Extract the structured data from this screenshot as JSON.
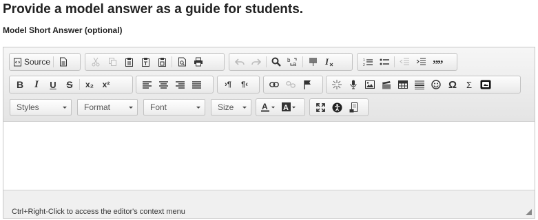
{
  "page": {
    "title": "Provide a model answer as a guide for students.",
    "subtitle": "Model Short Answer (optional)"
  },
  "toolbar": {
    "source_label": "Source",
    "combos": {
      "styles": "Styles",
      "format": "Format",
      "font": "Font",
      "size": "Size"
    },
    "row1_icons": [
      "source-icon",
      "templates-icon",
      "cut-icon",
      "copy-icon",
      "paste-icon",
      "paste-text-icon",
      "paste-word-icon",
      "preview-icon",
      "print-icon",
      "undo-icon",
      "redo-icon",
      "find-icon",
      "replace-icon",
      "select-all-icon",
      "remove-format-icon",
      "numbered-list-icon",
      "bulleted-list-icon",
      "decrease-indent-icon",
      "increase-indent-icon",
      "blockquote-icon"
    ],
    "row2_glyphs": {
      "bold": "B",
      "italic": "I",
      "underline": "U",
      "strike": "S",
      "subscript": "x₂",
      "superscript": "x²",
      "special_char": "Ω",
      "math": "Σ"
    }
  },
  "editor": {
    "context_hint": "Ctrl+Right-Click to access the editor's context menu"
  }
}
